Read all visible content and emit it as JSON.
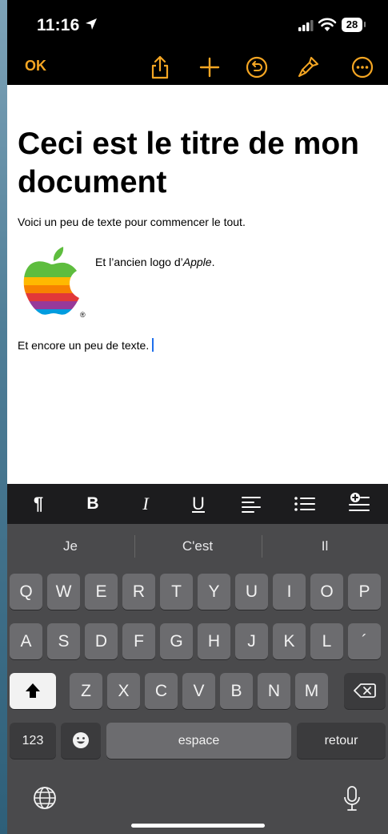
{
  "status_bar": {
    "time": "11:16",
    "battery": "28"
  },
  "toolbar": {
    "ok_label": "OK",
    "icons": [
      "share-icon",
      "add-icon",
      "undo-icon",
      "format-brush-icon",
      "more-icon"
    ]
  },
  "document": {
    "title": "Ceci est le titre de mon document",
    "intro": "Voici un peu de texte pour commencer le tout.",
    "caption_prefix": "Et l’ancien logo d’",
    "caption_italic": "Apple",
    "caption_suffix": ".",
    "last_line": "Et encore un peu de texte.",
    "registered_mark": "®"
  },
  "format_bar": {
    "paragraph": "¶",
    "bold": "B",
    "italic": "I",
    "underline": "U"
  },
  "keyboard": {
    "suggestions": [
      "Je",
      "C'est",
      "Il"
    ],
    "row1": [
      "Q",
      "W",
      "E",
      "R",
      "T",
      "Y",
      "U",
      "I",
      "O",
      "P"
    ],
    "row2": [
      "A",
      "S",
      "D",
      "F",
      "G",
      "H",
      "J",
      "K",
      "L",
      "´"
    ],
    "row3": [
      "Z",
      "X",
      "C",
      "V",
      "B",
      "N",
      "M"
    ],
    "numbers_label": "123",
    "space_label": "espace",
    "return_label": "retour"
  },
  "colors": {
    "accent": "#f5a623",
    "cursor": "#1f6feb"
  }
}
